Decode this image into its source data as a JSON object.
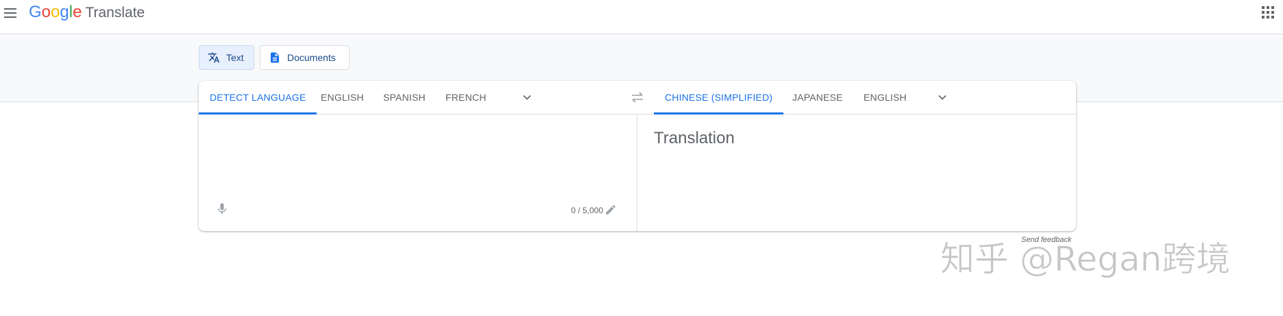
{
  "header": {
    "logo_letters": [
      "G",
      "o",
      "o",
      "g",
      "l",
      "e"
    ],
    "product": "Translate",
    "menu_icon": "hamburger-menu-icon",
    "apps_icon": "apps-grid-icon"
  },
  "modes": [
    {
      "label": "Text",
      "icon": "translate-icon",
      "active": true
    },
    {
      "label": "Documents",
      "icon": "document-icon",
      "active": false
    }
  ],
  "source_languages": [
    "DETECT LANGUAGE",
    "ENGLISH",
    "SPANISH",
    "FRENCH"
  ],
  "target_languages": [
    "CHINESE (SIMPLIFIED)",
    "JAPANESE",
    "ENGLISH"
  ],
  "source": {
    "value": "",
    "char_count": "0 / 5,000"
  },
  "target": {
    "placeholder": "Translation"
  },
  "footer": {
    "feedback": "Send feedback"
  },
  "watermark": "知乎 @Regan跨境",
  "colors": {
    "accent": "#1a73e8",
    "text_muted": "#5f6368",
    "border": "#dadce0",
    "band": "#f8f9fa"
  }
}
